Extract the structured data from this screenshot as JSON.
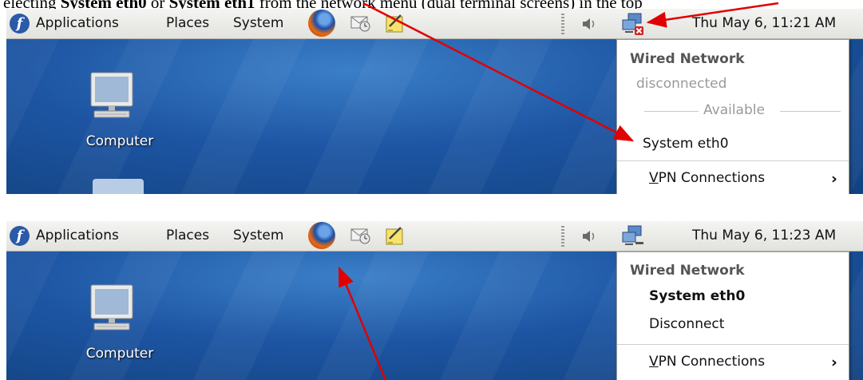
{
  "caption": {
    "pre": "electing ",
    "bold1": "System eth0",
    "mid": " or ",
    "bold2": "System eth1",
    "post": " from the network menu (dual terminal screens) in the top"
  },
  "screens": [
    {
      "panel": {
        "fedora_icon": "fedora-logo-icon",
        "fedora_glyph": "f",
        "menus": [
          "Applications",
          "Places",
          "System"
        ],
        "clock": "Thu May  6, 11:21 AM"
      },
      "desktop": {
        "computer_label": "Computer"
      },
      "network_menu": {
        "header": "Wired Network",
        "status": "disconnected",
        "available_label": "Available",
        "connection": "System eth0",
        "vpn_label": "VPN Connections",
        "vpn_underline_char": "V",
        "vpn_rest": "PN Connections",
        "chevron": "›"
      },
      "network_icon_state": "disconnected"
    },
    {
      "panel": {
        "fedora_icon": "fedora-logo-icon",
        "fedora_glyph": "f",
        "menus": [
          "Applications",
          "Places",
          "System"
        ],
        "clock": "Thu May  6, 11:23 AM"
      },
      "desktop": {
        "computer_label": "Computer"
      },
      "network_menu": {
        "header": "Wired Network",
        "connection": "System eth0",
        "action": "Disconnect",
        "vpn_underline_char": "V",
        "vpn_rest": "PN Connections",
        "chevron": "›"
      },
      "network_icon_state": "connected"
    }
  ],
  "colors": {
    "annotation_arrow": "#e00000",
    "desktop_blue": "#1d55a3"
  }
}
